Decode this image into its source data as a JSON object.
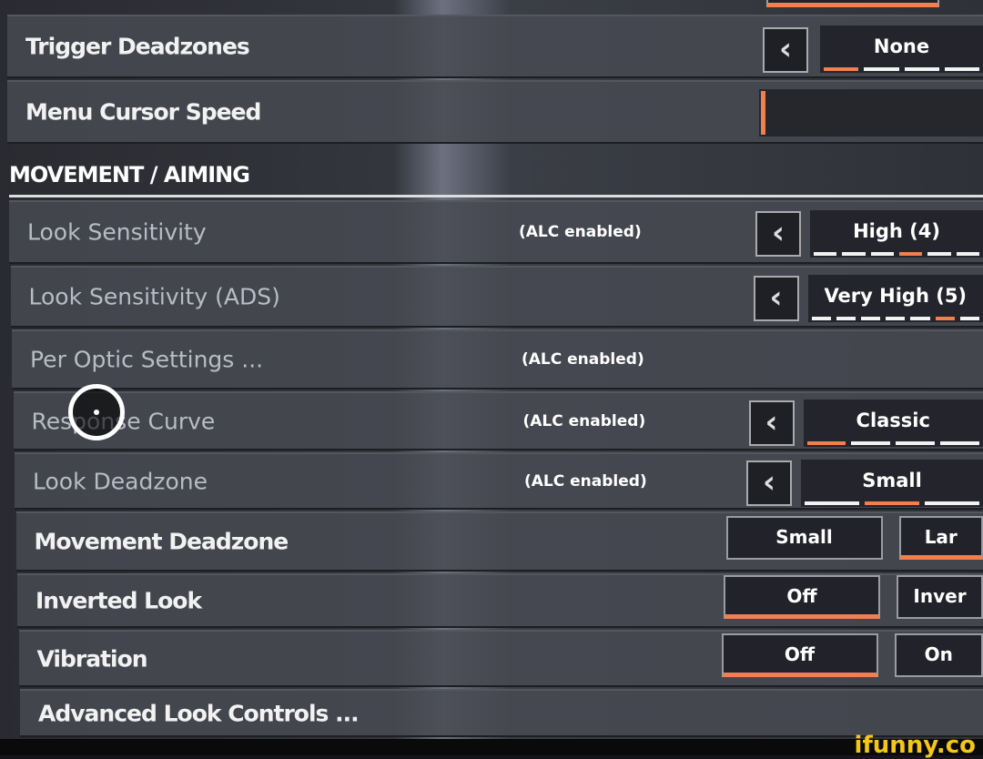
{
  "rows_top": [
    {
      "label": "Trigger Deadzones",
      "value": "None",
      "ticks": [
        1,
        0,
        0,
        0
      ]
    },
    {
      "label": "Menu Cursor Speed"
    }
  ],
  "section_title": "MOVEMENT / AIMING",
  "rows": [
    {
      "label": "Look Sensitivity",
      "note": "(ALC enabled)",
      "value": "High (4)",
      "ticks": [
        0,
        0,
        0,
        1,
        0,
        0
      ]
    },
    {
      "label": "Look Sensitivity (ADS)",
      "value": "Very High (5)",
      "ticks": [
        0,
        0,
        0,
        0,
        0,
        1,
        0
      ]
    },
    {
      "label": "Per Optic Settings ...",
      "note": "(ALC enabled)"
    },
    {
      "label": "Response Curve",
      "note": "(ALC enabled)",
      "value": "Classic",
      "ticks": [
        1,
        0,
        0,
        0
      ]
    },
    {
      "label": "Look Deadzone",
      "note": "(ALC enabled)",
      "value": "Small",
      "ticks": [
        0,
        1,
        0
      ]
    },
    {
      "label": "Movement Deadzone",
      "options": [
        "Small",
        "Lar"
      ],
      "active": 1
    },
    {
      "label": "Inverted Look",
      "options": [
        "Off",
        "Inver"
      ],
      "active": 0
    },
    {
      "label": "Vibration",
      "options": [
        "Off",
        "On"
      ],
      "active": 0
    },
    {
      "label": "Advanced Look Controls ..."
    }
  ],
  "watermark": "ifunny.co",
  "colors": {
    "accent": "#f08050",
    "panel": "#484a52"
  }
}
